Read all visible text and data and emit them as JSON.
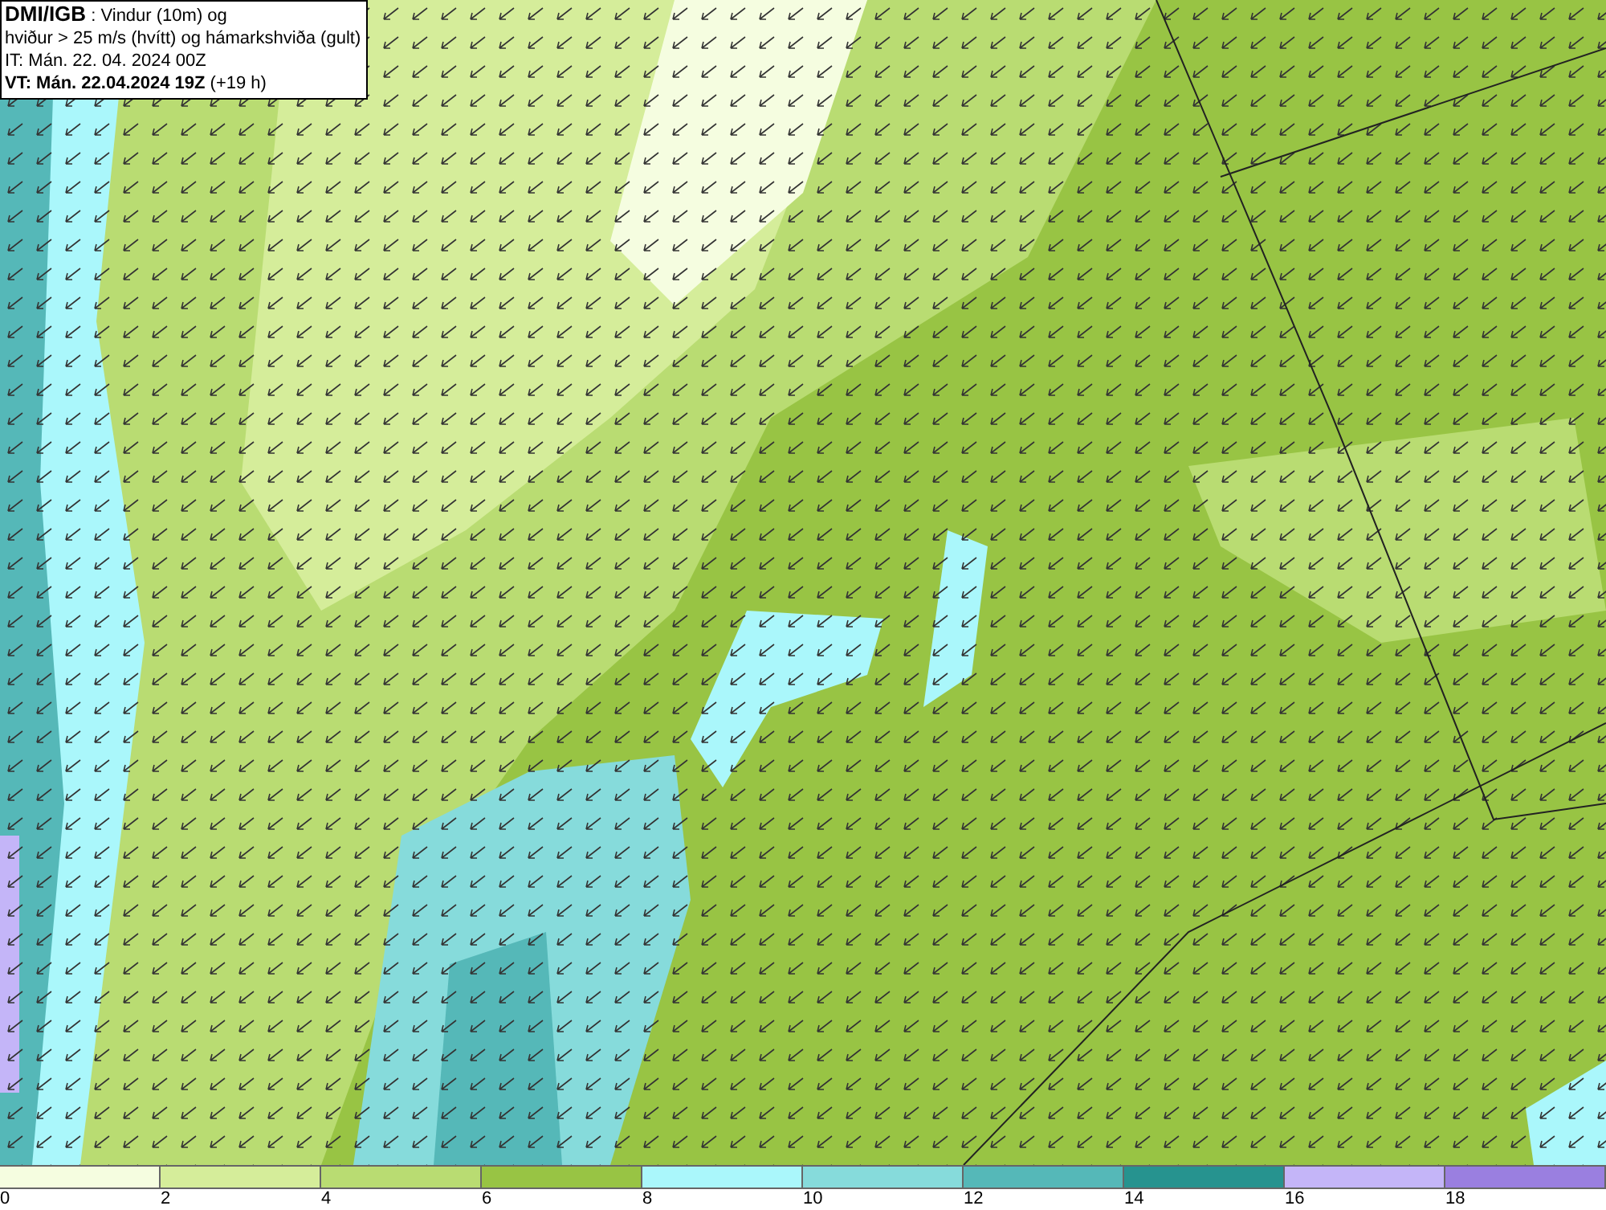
{
  "header": {
    "source": "DMI/IGB",
    "subject": ": Vindur (10m) og",
    "line2": "hviður > 25 m/s (hvítt) og hámarkshviða (gult)",
    "init": "IT: Mán. 22. 04. 2024 00Z",
    "valid": "**VT: Mán. 22.04.2024 19Z** (+19 h)"
  },
  "legend": {
    "bins": [
      {
        "color": "#f5fde0"
      },
      {
        "color": "#d5ed9a"
      },
      {
        "color": "#b9dc72"
      },
      {
        "color": "#98c444"
      },
      {
        "color": "#aaf7fb"
      },
      {
        "color": "#86dbdb"
      },
      {
        "color": "#55b8b8"
      },
      {
        "color": "#26938f"
      },
      {
        "color": "#c4b5f8"
      },
      {
        "color": "#9a7fe0"
      }
    ],
    "ticks": [
      "0",
      "2",
      "4",
      "6",
      "8",
      "10",
      "12",
      "14",
      "16",
      "18"
    ]
  }
}
